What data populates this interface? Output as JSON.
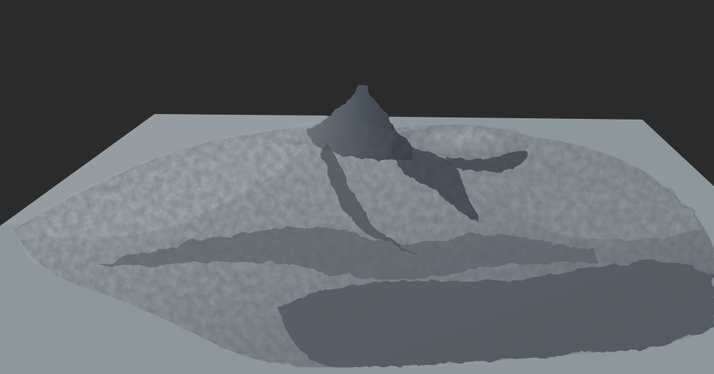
{
  "scene": {
    "background_color": "#2b2b2b",
    "plane_color": "#8e979c",
    "terrain_light_color": "#9aa2a8",
    "terrain_mid_color": "#6f777e",
    "terrain_dark_color": "#3a4048",
    "shadow_color": "#2e343c"
  }
}
